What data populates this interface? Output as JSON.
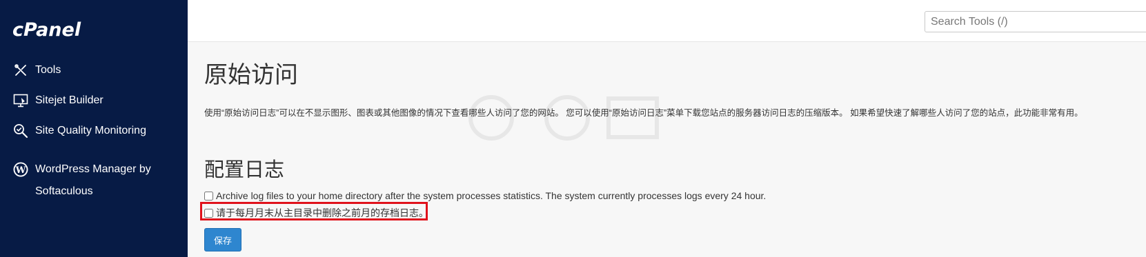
{
  "app": {
    "logo_text": "cPanel"
  },
  "sidebar": {
    "items": [
      {
        "label": "Tools",
        "icon": "tools-icon"
      },
      {
        "label": "Sitejet Builder",
        "icon": "sitejet-builder-icon"
      },
      {
        "label": "Site Quality Monitoring",
        "icon": "site-quality-monitoring-icon"
      },
      {
        "label": "WordPress Manager by Softaculous",
        "icon": "wordpress-icon"
      }
    ]
  },
  "header": {
    "search_placeholder": "Search Tools (/)"
  },
  "main": {
    "page_title": "原始访问",
    "description": "使用“原始访问日志”可以在不显示图形、图表或其他图像的情况下查看哪些人访问了您的网站。 您可以使用“原始访问日志”菜单下载您站点的服务器访问日志的压缩版本。 如果希望快速了解哪些人访问了您的站点，此功能非常有用。",
    "section_title": "配置日志",
    "options": [
      {
        "label": "Archive log files to your home directory after the system processes statistics. The system currently processes logs every 24 hour.",
        "checked": false
      },
      {
        "label": "请于每月月末从主目录中删除之前月的存档日志。",
        "checked": false
      }
    ],
    "save_label": "保存"
  },
  "colors": {
    "sidebar_bg": "#071b45",
    "highlight_border": "#e0121c",
    "button_bg": "#2e86cf"
  }
}
